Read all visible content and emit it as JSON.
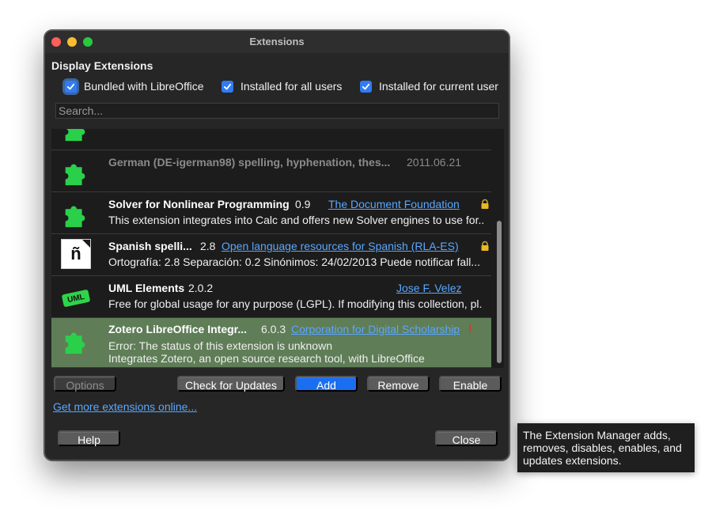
{
  "window": {
    "title": "Extensions"
  },
  "display": {
    "label": "Display Extensions",
    "checkboxes": [
      {
        "label": "Bundled with LibreOffice",
        "checked": true
      },
      {
        "label": "Installed for all users",
        "checked": true
      },
      {
        "label": "Installed for current user",
        "checked": true
      }
    ]
  },
  "search": {
    "placeholder": "Search..."
  },
  "extensions": [
    {
      "name": "German (DE-igerman98) spelling, hyphenation, thes...",
      "version": "2011.06.21",
      "icon": "puzzle-icon",
      "disabled": true
    },
    {
      "name": "Solver for Nonlinear Programming",
      "version": "0.9",
      "publisher": "The Document Foundation",
      "description": "This extension integrates into Calc and offers new Solver engines to use for..",
      "icon": "puzzle-icon",
      "locked": true
    },
    {
      "name": "Spanish spelli...",
      "version": "2.8",
      "publisher": "Open language resources for Spanish (RLA-ES)",
      "description": "Ortografía: 2.8 Separación: 0.2 Sinónimos: 24/02/2013  Puede notificar fall...",
      "icon": "spanish-n-icon",
      "icon_glyph": "ñ",
      "locked": true
    },
    {
      "name": "UML Elements",
      "version": "2.0.2",
      "publisher": "Jose F. Velez",
      "description": "Free for global usage for any purpose (LGPL). If modifying this collection, pl.",
      "icon": "uml-icon",
      "icon_text": "UML"
    },
    {
      "name": "Zotero LibreOffice Integr...",
      "version": "6.0.3",
      "publisher": "Corporation for Digital Scholarship",
      "error": "Error: The status of this extension is unknown",
      "description": "Integrates Zotero, an open source research tool, with LibreOffice",
      "icon": "puzzle-icon",
      "selected": true,
      "warning": "!"
    }
  ],
  "buttons": {
    "options": "Options",
    "check_updates": "Check for Updates",
    "add": "Add",
    "remove": "Remove",
    "enable": "Enable",
    "help": "Help",
    "close": "Close"
  },
  "more_link": "Get more extensions online...",
  "tooltip": "The Extension Manager adds, removes, disables, enables, and updates extensions.",
  "colors": {
    "accent": "#1a6ff0",
    "link": "#5aa7ff",
    "selected_row": "#5f7d57",
    "puzzle_green": "#2bd04a"
  }
}
